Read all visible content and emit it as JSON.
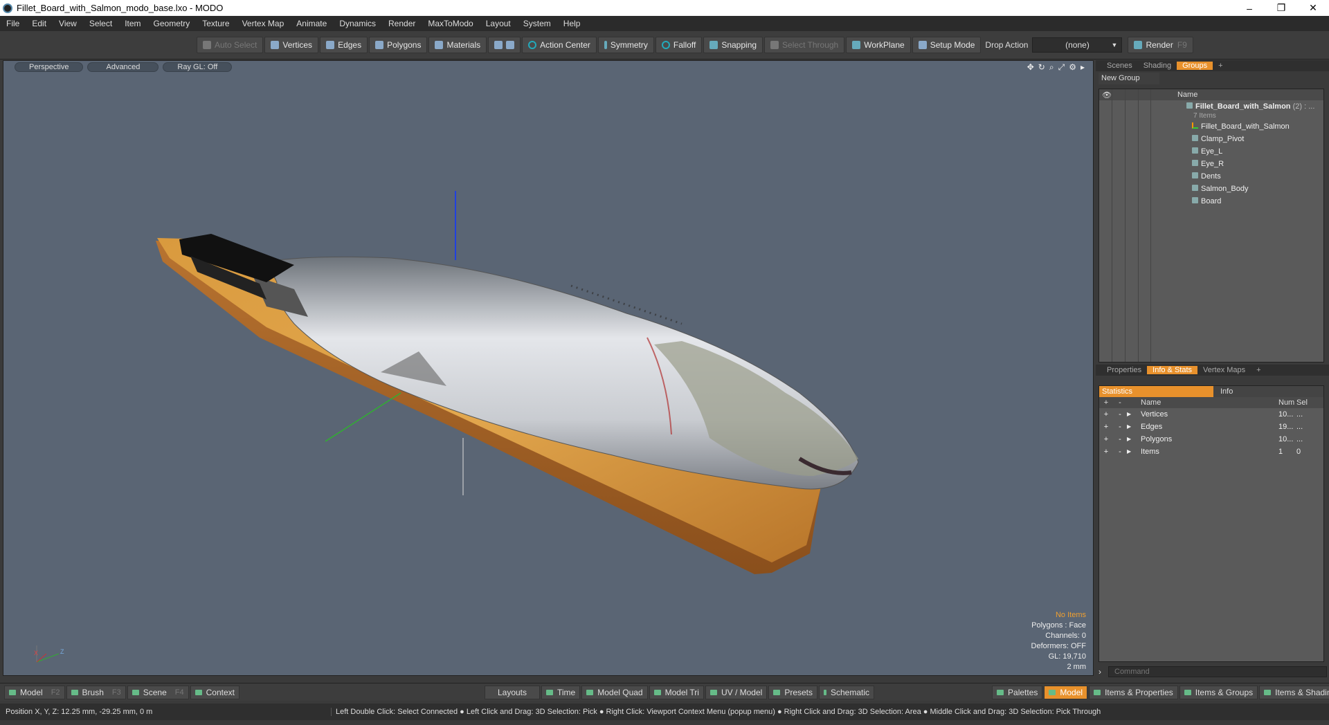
{
  "window": {
    "title": "Fillet_Board_with_Salmon_modo_base.lxo - MODO",
    "controls": [
      "–",
      "❐",
      "✕"
    ]
  },
  "menu": [
    "File",
    "Edit",
    "View",
    "Select",
    "Item",
    "Geometry",
    "Texture",
    "Vertex Map",
    "Animate",
    "Dynamics",
    "Render",
    "MaxToModo",
    "Layout",
    "System",
    "Help"
  ],
  "toolbar": {
    "auto_select": "Auto Select",
    "vertices": "Vertices",
    "edges": "Edges",
    "polygons": "Polygons",
    "materials": "Materials",
    "action_center": "Action Center",
    "symmetry": "Symmetry",
    "falloff": "Falloff",
    "snapping": "Snapping",
    "select_through": "Select Through",
    "workplane": "WorkPlane",
    "setup_mode": "Setup Mode",
    "drop_action_label": "Drop Action",
    "drop_action_value": "(none)",
    "render": "Render",
    "render_key": "F9"
  },
  "viewport": {
    "perspective": "Perspective",
    "advanced": "Advanced",
    "raygl": "Ray GL: Off",
    "info": {
      "items": "No Items",
      "polygons": "Polygons : Face",
      "channels": "Channels: 0",
      "deformers": "Deformers: OFF",
      "gl": "GL: 19,710",
      "scale": "2 mm"
    },
    "axes": {
      "x": "X",
      "z": "Z"
    }
  },
  "groups_panel": {
    "tabs": [
      "Scenes",
      "Shading",
      "Groups"
    ],
    "active_tab": "Groups",
    "add": "+",
    "new_group": "New Group",
    "name_header": "Name",
    "root": {
      "name": "Fillet_Board_with_Salmon",
      "count": "(2) : ...",
      "sub": "7 Items"
    },
    "items": [
      "Fillet_Board_with_Salmon",
      "Clamp_Pivot",
      "Eye_L",
      "Eye_R",
      "Dents",
      "Salmon_Body",
      "Board"
    ]
  },
  "props_panel": {
    "tabs": [
      "Properties",
      "Info & Stats",
      "Vertex Maps"
    ],
    "active_tab": "Info & Stats",
    "add": "+",
    "stats_tab": "Statistics",
    "info_tab": "Info",
    "headers": {
      "name": "Name",
      "num": "Num",
      "sel": "Sel"
    },
    "rows": [
      {
        "name": "Vertices",
        "num": "10...",
        "sel": "..."
      },
      {
        "name": "Edges",
        "num": "19...",
        "sel": "..."
      },
      {
        "name": "Polygons",
        "num": "10...",
        "sel": "..."
      },
      {
        "name": "Items",
        "num": "1",
        "sel": "0"
      }
    ],
    "command_placeholder": "Command"
  },
  "bottombar": {
    "model": "Model",
    "model_key": "F2",
    "brush": "Brush",
    "brush_key": "F3",
    "scene": "Scene",
    "scene_key": "F4",
    "context": "Context",
    "layouts": "Layouts",
    "time": "Time",
    "model_quad": "Model Quad",
    "model_tri": "Model Tri",
    "uv_model": "UV / Model",
    "presets": "Presets",
    "schematic": "Schematic",
    "palettes": "Palettes",
    "model_active": "Model",
    "items_props": "Items & Properties",
    "items_groups": "Items & Groups",
    "items_shading": "Items & Shading"
  },
  "status": {
    "position": "Position X, Y, Z:   12.25 mm, -29.25 mm, 0 m",
    "hint": "Left Double Click: Select Connected ● Left Click and Drag: 3D Selection: Pick ● Right Click: Viewport Context Menu (popup menu) ● Right Click and Drag: 3D Selection: Area ● Middle Click and Drag: 3D Selection: Pick Through"
  },
  "colors": {
    "accent": "#e8912c",
    "viewport_bg": "#5a6574"
  }
}
